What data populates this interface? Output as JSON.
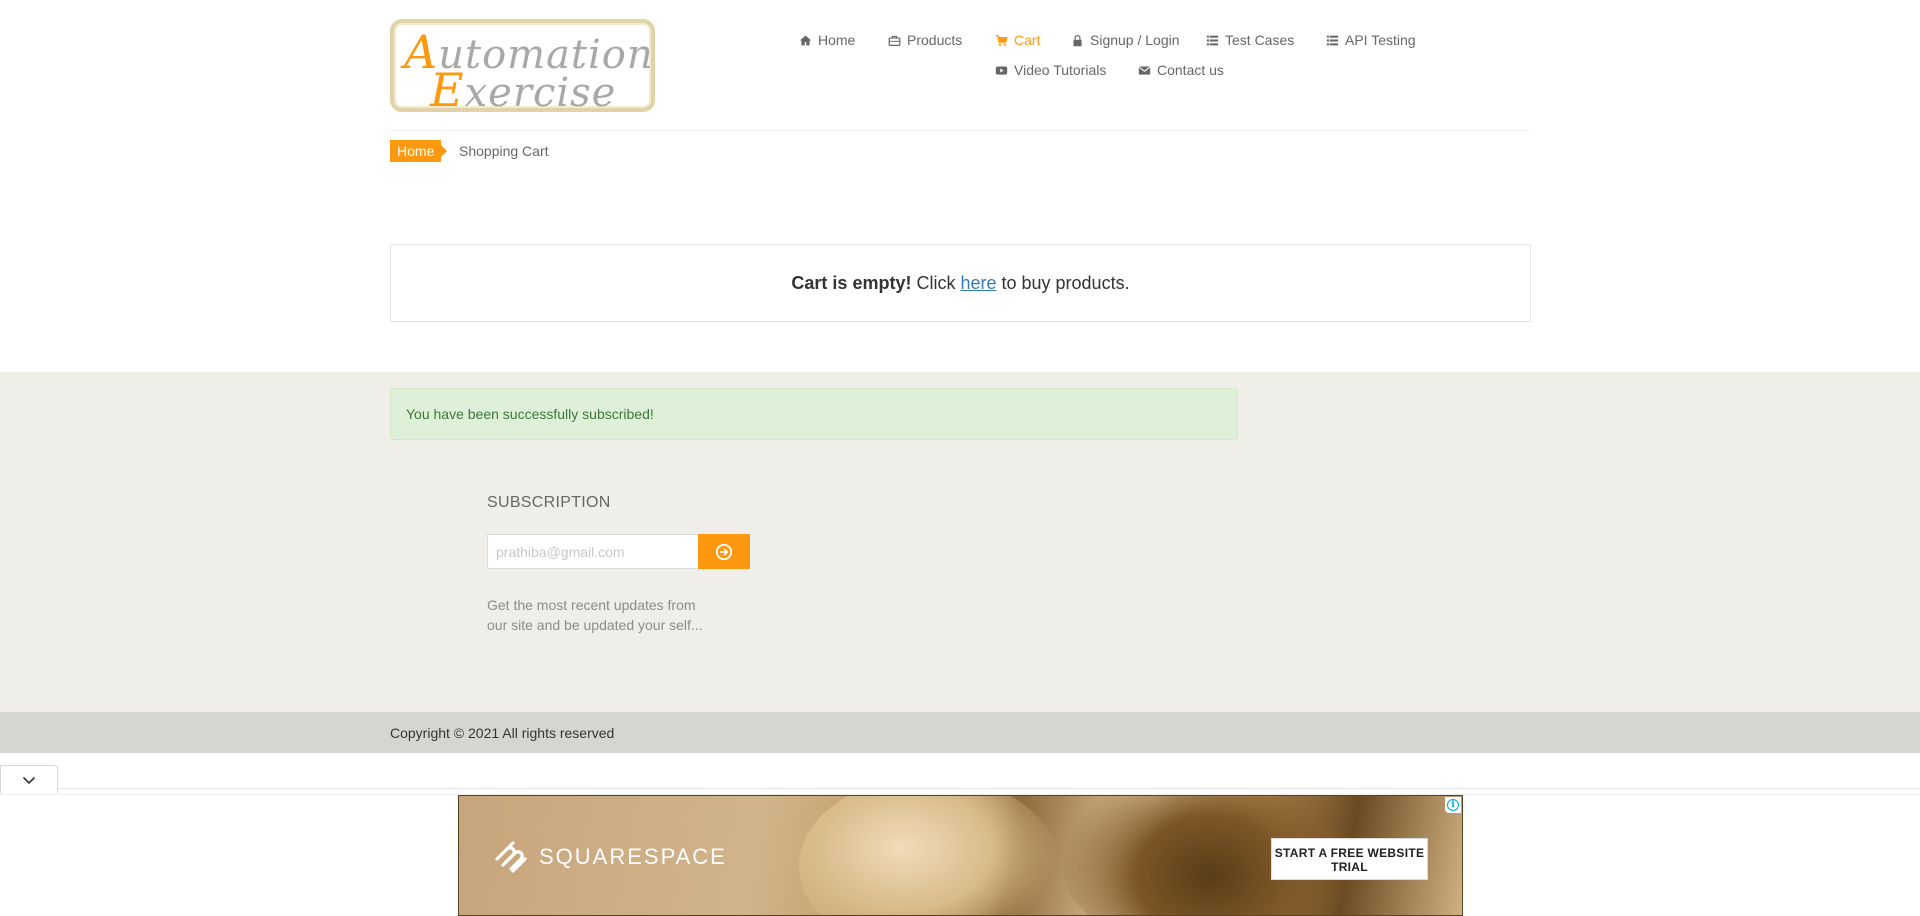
{
  "logo": {
    "line1_cap": "A",
    "line1_rest": "utomation",
    "line2_cap": "E",
    "line2_rest": "xercise"
  },
  "nav": {
    "home": "Home",
    "products": "Products",
    "cart": "Cart",
    "signup_login": "Signup / Login",
    "test_cases": "Test Cases",
    "api_testing": "API Testing",
    "video_tutorials": "Video Tutorials",
    "contact_us": "Contact us",
    "active": "Cart",
    "accent_color": "#fe980f"
  },
  "breadcrumb": {
    "home": "Home",
    "current": "Shopping Cart"
  },
  "cart": {
    "empty_bold": "Cart is empty!",
    "empty_pre_link": "Click",
    "empty_link": "here",
    "empty_post_link": "to buy products."
  },
  "alert": {
    "message": "You have been successfully subscribed!"
  },
  "subscription": {
    "title": "SUBSCRIPTION",
    "placeholder": "prathiba@gmail.com",
    "description": "Get the most recent updates from our site and be updated your self..."
  },
  "footer": {
    "copyright": "Copyright © 2021 All rights reserved"
  },
  "ad": {
    "brand": "SQUARESPACE",
    "cta": "START A FREE WEBSITE TRIAL",
    "info_icon": "i"
  }
}
